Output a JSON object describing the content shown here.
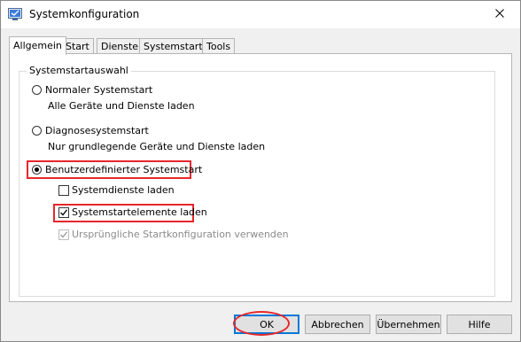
{
  "window": {
    "title": "Systemkonfiguration",
    "app_icon": "msconfig-icon",
    "close_icon": "close-icon"
  },
  "tabs": [
    {
      "label": "Allgemein",
      "active": true
    },
    {
      "label": "Start",
      "active": false
    },
    {
      "label": "Dienste",
      "active": false
    },
    {
      "label": "Systemstart",
      "active": false
    },
    {
      "label": "Tools",
      "active": false
    }
  ],
  "group": {
    "title": "Systemstartauswahl",
    "options": {
      "normal": {
        "label": "Normaler Systemstart",
        "description": "Alle Geräte und Dienste laden",
        "checked": false
      },
      "diagnostic": {
        "label": "Diagnosesystemstart",
        "description": "Nur grundlegende Geräte und Dienste laden",
        "checked": false
      },
      "custom": {
        "label": "Benutzerdefinierter Systemstart",
        "checked": true
      }
    },
    "checkboxes": {
      "services": {
        "label": "Systemdienste laden",
        "checked": false,
        "enabled": true
      },
      "startup_items": {
        "label": "Systemstartelemente laden",
        "checked": true,
        "enabled": true
      },
      "original_config": {
        "label": "Ursprüngliche Startkonfiguration verwenden",
        "checked": true,
        "enabled": false
      }
    }
  },
  "buttons": {
    "ok": "OK",
    "cancel": "Abbrechen",
    "apply": "Übernehmen",
    "help": "Hilfe"
  },
  "colors": {
    "annotation_red": "#e8262b",
    "default_button_border": "#0078d7"
  }
}
